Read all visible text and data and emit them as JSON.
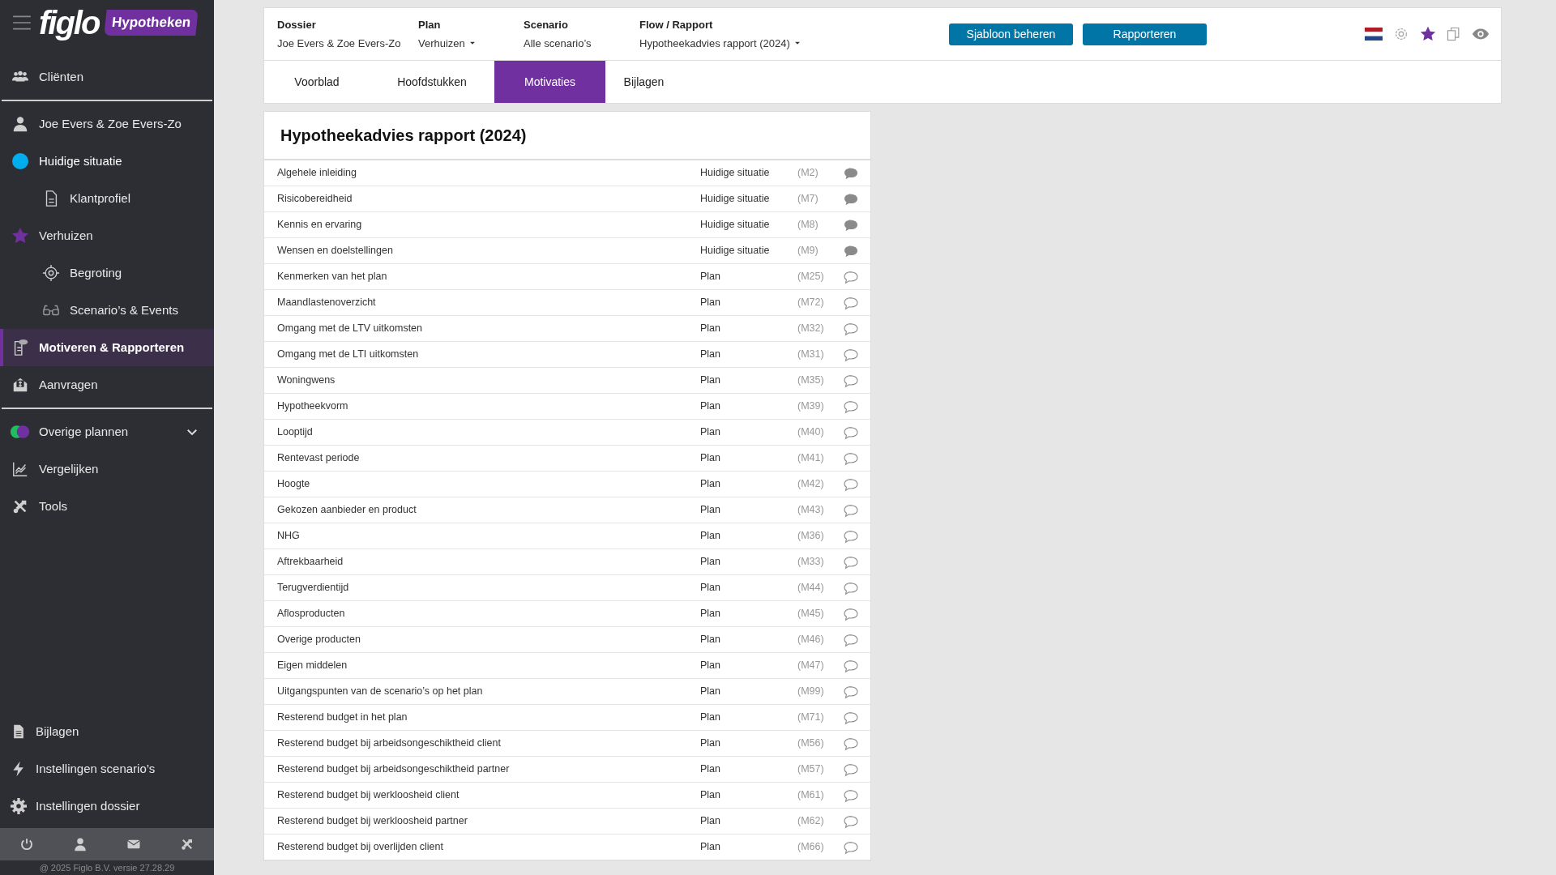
{
  "sidebar": {
    "logo": "figlo",
    "product": "Hypotheken",
    "items": [
      {
        "label": "Cliënten",
        "kind": "main",
        "selected": false
      },
      {
        "label": "Joe Evers & Zoe Evers-Zo",
        "kind": "main",
        "selected": false
      },
      {
        "label": "Huidige situatie",
        "kind": "main",
        "selected": false,
        "color": "#00aeef"
      },
      {
        "label": "Klantprofiel",
        "kind": "sub",
        "selected": false
      },
      {
        "label": "Verhuizen",
        "kind": "main",
        "selected": false
      },
      {
        "label": "Begroting",
        "kind": "sub",
        "selected": false
      },
      {
        "label": "Scenario’s & Events",
        "kind": "sub",
        "selected": false
      },
      {
        "label": "Motiveren & Rapporteren",
        "kind": "main",
        "selected": true
      },
      {
        "label": "Aanvragen",
        "kind": "main",
        "selected": false
      },
      {
        "label": "Overige plannen",
        "kind": "group",
        "selected": false,
        "expanded": false
      },
      {
        "label": "Vergelijken",
        "kind": "main",
        "selected": false
      },
      {
        "label": "Tools",
        "kind": "main",
        "selected": false
      }
    ],
    "bottom_items": [
      {
        "label": "Bijlagen"
      },
      {
        "label": "Instellingen scenario’s"
      },
      {
        "label": "Instellingen dossier"
      }
    ],
    "footer": "@ 2025 Figlo B.V. versie 27.28.29"
  },
  "header": {
    "fields": [
      {
        "label": "Dossier",
        "value": "Joe Evers & Zoe Evers-Zo",
        "dropdown": false
      },
      {
        "label": "Plan",
        "value": "Verhuizen",
        "dropdown": true
      },
      {
        "label": "Scenario",
        "value": "Alle scenario’s",
        "dropdown": false
      },
      {
        "label": "Flow / Rapport",
        "value": "Hypotheekadvies rapport (2024)",
        "dropdown": true
      }
    ],
    "buttons": [
      "Sjabloon beheren",
      "Rapporteren"
    ]
  },
  "tabs": [
    {
      "label": "Voorblad",
      "selected": false
    },
    {
      "label": "Hoofdstukken",
      "selected": false
    },
    {
      "label": "Motivaties",
      "selected": true
    },
    {
      "label": "Bijlagen",
      "selected": false
    }
  ],
  "report": {
    "title": "Hypotheekadvies rapport (2024)",
    "rows": [
      {
        "title": "Algehele inleiding",
        "section": "Huidige situatie",
        "code": "(M2)",
        "commented": true
      },
      {
        "title": "Risicobereidheid",
        "section": "Huidige situatie",
        "code": "(M7)",
        "commented": true
      },
      {
        "title": "Kennis en ervaring",
        "section": "Huidige situatie",
        "code": "(M8)",
        "commented": true
      },
      {
        "title": "Wensen en doelstellingen",
        "section": "Huidige situatie",
        "code": "(M9)",
        "commented": true
      },
      {
        "title": "Kenmerken van het plan",
        "section": "Plan",
        "code": "(M25)",
        "commented": false
      },
      {
        "title": "Maandlastenoverzicht",
        "section": "Plan",
        "code": "(M72)",
        "commented": false
      },
      {
        "title": "Omgang met de LTV uitkomsten",
        "section": "Plan",
        "code": "(M32)",
        "commented": false
      },
      {
        "title": "Omgang met de LTI uitkomsten",
        "section": "Plan",
        "code": "(M31)",
        "commented": false
      },
      {
        "title": "Woningwens",
        "section": "Plan",
        "code": "(M35)",
        "commented": false
      },
      {
        "title": "Hypotheekvorm",
        "section": "Plan",
        "code": "(M39)",
        "commented": false
      },
      {
        "title": "Looptijd",
        "section": "Plan",
        "code": "(M40)",
        "commented": false
      },
      {
        "title": "Rentevast periode",
        "section": "Plan",
        "code": "(M41)",
        "commented": false
      },
      {
        "title": "Hoogte",
        "section": "Plan",
        "code": "(M42)",
        "commented": false
      },
      {
        "title": "Gekozen aanbieder en product",
        "section": "Plan",
        "code": "(M43)",
        "commented": false
      },
      {
        "title": "NHG",
        "section": "Plan",
        "code": "(M36)",
        "commented": false
      },
      {
        "title": "Aftrekbaarheid",
        "section": "Plan",
        "code": "(M33)",
        "commented": false
      },
      {
        "title": "Terugverdientijd",
        "section": "Plan",
        "code": "(M44)",
        "commented": false
      },
      {
        "title": "Aflosproducten",
        "section": "Plan",
        "code": "(M45)",
        "commented": false
      },
      {
        "title": "Overige producten",
        "section": "Plan",
        "code": "(M46)",
        "commented": false
      },
      {
        "title": "Eigen middelen",
        "section": "Plan",
        "code": "(M47)",
        "commented": false
      },
      {
        "title": "Uitgangspunten van de scenario’s op het plan",
        "section": "Plan",
        "code": "(M99)",
        "commented": false
      },
      {
        "title": "Resterend budget in het plan",
        "section": "Plan",
        "code": "(M71)",
        "commented": false
      },
      {
        "title": "Resterend budget bij arbeidsongeschiktheid client",
        "section": "Plan",
        "code": "(M56)",
        "commented": false
      },
      {
        "title": "Resterend budget bij arbeidsongeschiktheid partner",
        "section": "Plan",
        "code": "(M57)",
        "commented": false
      },
      {
        "title": "Resterend budget bij werkloosheid client",
        "section": "Plan",
        "code": "(M61)",
        "commented": false
      },
      {
        "title": "Resterend budget bij werkloosheid partner",
        "section": "Plan",
        "code": "(M62)",
        "commented": false
      },
      {
        "title": "Resterend budget bij overlijden client",
        "section": "Plan",
        "code": "(M66)",
        "commented": false
      }
    ]
  }
}
